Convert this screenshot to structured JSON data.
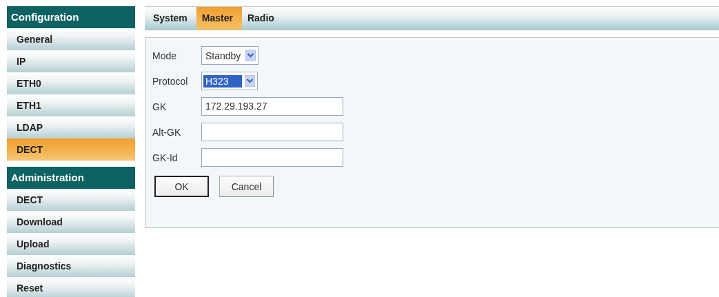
{
  "sidebar": {
    "sections": [
      {
        "title": "Configuration",
        "items": [
          {
            "label": "General",
            "selected": false
          },
          {
            "label": "IP",
            "selected": false
          },
          {
            "label": "ETH0",
            "selected": false
          },
          {
            "label": "ETH1",
            "selected": false
          },
          {
            "label": "LDAP",
            "selected": false
          },
          {
            "label": "DECT",
            "selected": true
          }
        ]
      },
      {
        "title": "Administration",
        "items": [
          {
            "label": "DECT",
            "selected": false
          },
          {
            "label": "Download",
            "selected": false
          },
          {
            "label": "Upload",
            "selected": false
          },
          {
            "label": "Diagnostics",
            "selected": false
          },
          {
            "label": "Reset",
            "selected": false
          }
        ]
      }
    ]
  },
  "tabs": [
    {
      "label": "System",
      "selected": false
    },
    {
      "label": "Master",
      "selected": true
    },
    {
      "label": "Radio",
      "selected": false
    }
  ],
  "form": {
    "fields": [
      {
        "label": "Mode",
        "kind": "select",
        "value": "Standby",
        "focused": false
      },
      {
        "label": "Protocol",
        "kind": "select",
        "value": "H323",
        "focused": true
      },
      {
        "label": "GK",
        "kind": "text",
        "value": "172.29.193.27"
      },
      {
        "label": "Alt-GK",
        "kind": "text"
      },
      {
        "label": "GK-Id",
        "kind": "text"
      }
    ],
    "buttons": [
      {
        "label": "OK",
        "default": true
      },
      {
        "label": "Cancel",
        "default": false
      }
    ]
  }
}
